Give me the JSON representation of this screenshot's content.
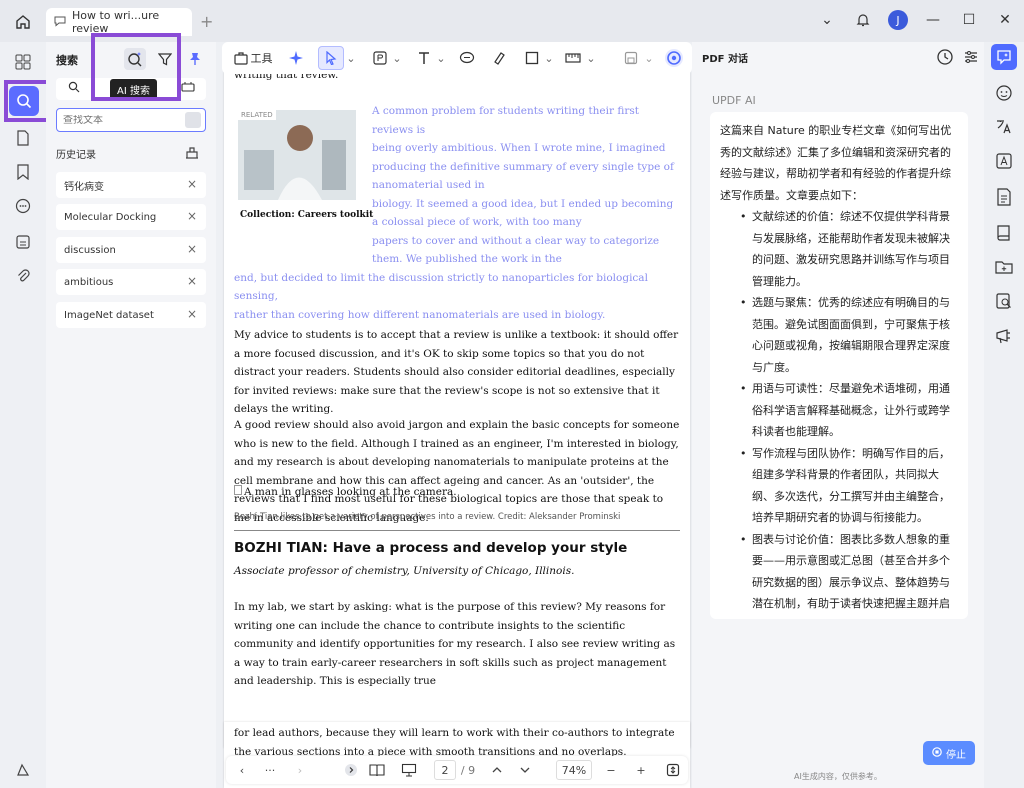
{
  "titlebar": {
    "tab_title": "How to wri...ure review",
    "avatar_initial": "J"
  },
  "search_panel": {
    "title": "搜索",
    "tooltip": "AI 搜索",
    "input_placeholder": "查找文本",
    "history_title": "历史记录",
    "history_items": [
      "钙化病变",
      "Molecular Docking",
      "discussion",
      "ambitious",
      "ImageNet dataset"
    ],
    "close_symbol": "×"
  },
  "toolbar": {
    "tools_label": "工具"
  },
  "document": {
    "top_partial": "writing that review.",
    "related_tag": "RELATED",
    "related_text_1": "A common problem for students writing their first reviews is",
    "related_text_2": "being overly ambitious. When I wrote mine, I imagined",
    "related_text_3": "producing the definitive summary of every single type of nanomaterial used in",
    "related_text_4": "biology. It seemed a good idea, but I ended up becoming a colossal piece of work, with too many",
    "related_text_5": "papers to cover and without a clear way to categorize them. We published the work in the",
    "related_text_6": "end, but decided to limit the discussion strictly to nanoparticles for biological sensing,",
    "related_text_7": "rather than covering how different nanomaterials are used in biology.",
    "collection": "Collection: Careers toolkit",
    "para1": "My advice to students is to accept that a review is unlike a textbook: it should offer a more focused discussion, and it's OK to skip some topics so that you do not distract your readers. Students should also consider editorial deadlines, especially for invited reviews: make sure that the review's scope is not so extensive that it delays the writing.",
    "para2": "A good review should also avoid jargon and explain the basic concepts for someone who is new to the field. Although I trained as an engineer, I'm interested in biology, and my research is about developing nanomaterials to manipulate proteins at the cell membrane and how this can affect ageing and cancer. As an 'outsider', the reviews that I find most useful for these biological topics are those that speak to me in accessible scientific language.",
    "img_alt": "A man in glasses looking at the camera.",
    "caption": "Bozhi Tian likes to get a variety of perspectives into a review.  Credit: Aleksander Prominski",
    "heading": "BOZHI TIAN: Have a process and develop your style",
    "subheading": "Associate professor of chemistry, University of Chicago, Illinois.",
    "para3": "In my lab, we start by asking: what is the purpose of this review? My reasons for writing one can include the chance to contribute insights to the scientific community and identify opportunities for my research. I also see review writing as a way to train early-career researchers in soft skills such as project management and leadership. This is especially true",
    "page2_text": "for lead authors, because they will learn to work with their co-authors to integrate the various sections into a piece with smooth transitions and no overlaps."
  },
  "bottom_nav": {
    "ellipsis": "···",
    "page_current": "2",
    "page_total": "/ 9",
    "zoom": "74%"
  },
  "chat_panel": {
    "title": "PDF 对话",
    "assistant_name": "UPDF AI",
    "intro": "这篇来自 Nature 的职业专栏文章《如何写出优秀的文献综述》汇集了多位编辑和资深研究者的经验与建议，帮助初学者和有经验的作者提升综述写作质量。文章要点如下：",
    "points": [
      "文献综述的价值：综述不仅提供学科背景与发展脉络，还能帮助作者发现未被解决的问题、激发研究思路并训练写作与项目管理能力。",
      "选题与聚焦：优秀的综述应有明确目的与范围。避免试图面面俱到，宁可聚焦于核心问题或视角，按编辑期限合理界定深度与广度。",
      "用语与可读性：尽量避免术语堆砌，用通俗科学语言解释基础概念，让外行或跨学科读者也能理解。",
      "写作流程与团队协作：明确写作目的后，组建多学科背景的作者团队，共同拟大纲、多次迭代，分工撰写并由主编整合，培养早期研究者的协调与衔接能力。",
      "图表与讨论价值：图表比多数人想象的重要——用示意图或汇总图（甚至合并多个研究数据的图）展示争议点、整体趋势与潜在机制，有助于读者快速把握主题并启发未来研究方向。"
    ],
    "stop_label": "停止",
    "disclaimer": "AI生成内容，仅供参考。"
  },
  "colors": {
    "accent": "#5b6cff",
    "highlight_box": "#8a4bd6",
    "related_text": "#8a8ff0",
    "stop_button": "#5b8cff"
  }
}
